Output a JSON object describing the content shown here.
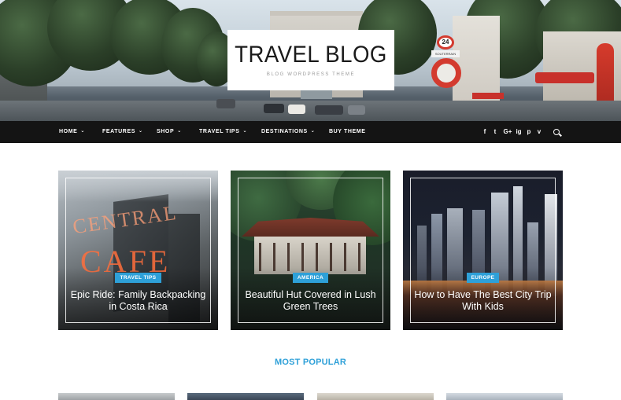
{
  "header": {
    "title": "TRAVEL BLOG",
    "tagline": "BLOG WORDPRESS THEME",
    "sign_speed": "24",
    "sign_plate": "SOUTERRAIN"
  },
  "nav": {
    "items": [
      {
        "label": "HOME"
      },
      {
        "label": "FEATURES"
      },
      {
        "label": "SHOP"
      },
      {
        "label": "TRAVEL TIPS"
      },
      {
        "label": "DESTINATIONS"
      },
      {
        "label": "BUY THEME"
      }
    ],
    "chevron": "⌄",
    "social": [
      "f",
      "t",
      "G+",
      "ig",
      "p",
      "v"
    ],
    "social_icons": [
      "facebook-icon",
      "twitter-icon",
      "google-plus-icon",
      "instagram-icon",
      "pinterest-icon",
      "vimeo-icon"
    ]
  },
  "featured": [
    {
      "badge": "TRAVEL TIPS",
      "title_line1": "Epic Ride: Family Backpacking",
      "title_line2": "in Costa Rica",
      "sign_text_1": "CENTRAL",
      "sign_text_2": "CAFE"
    },
    {
      "badge": "AMERICA",
      "title_line1": "Beautiful Hut Covered in Lush",
      "title_line2": "Green Trees"
    },
    {
      "badge": "EUROPE",
      "title_line1": "How to Have The Best City Trip",
      "title_line2": "With Kids"
    }
  ],
  "most_popular": {
    "title": "MOST POPULAR"
  },
  "colors": {
    "accent": "#2ea0d8",
    "nav_bg": "#141414"
  }
}
